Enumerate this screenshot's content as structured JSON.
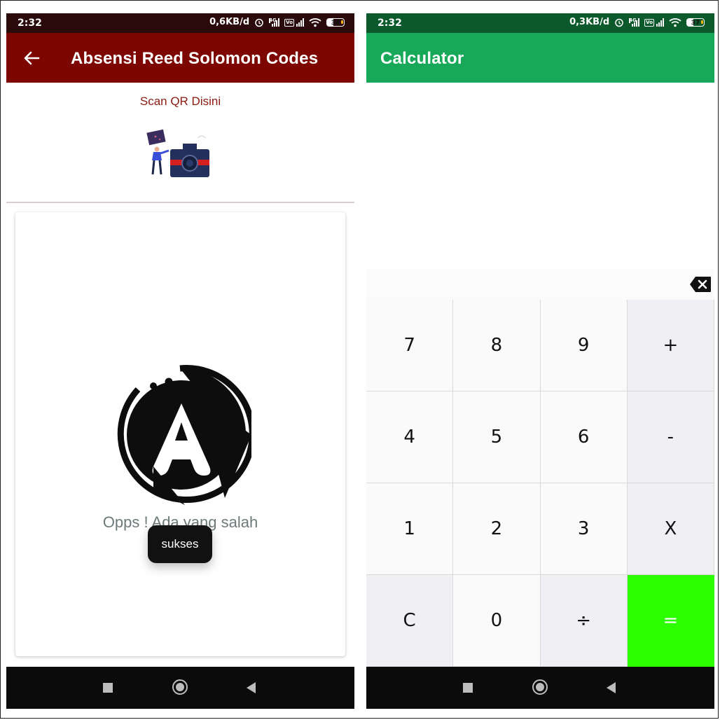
{
  "left": {
    "status_time": "2:32",
    "status_speed": "0,6KB/d",
    "battery": "38",
    "battery_level": 0.38,
    "title": "Absensi Reed Solomon Codes",
    "scan_label": "Scan QR Disini",
    "error_text": "Opps ! Ada yang salah",
    "toast": "sukses",
    "colors": {
      "appbar": "#7e0600",
      "statusbar": "#2a0a0a",
      "scan_label": "#8b1a10"
    },
    "icons": [
      "back-arrow-icon",
      "scan-illustration",
      "app-logo-icon"
    ]
  },
  "right": {
    "status_time": "2:32",
    "status_speed": "0,3KB/d",
    "battery": "37",
    "battery_level": 0.37,
    "title": "Calculator",
    "colors": {
      "appbar": "#18a85a",
      "statusbar": "#0c5a2c",
      "equals": "#2cff00"
    },
    "keys": [
      "7",
      "8",
      "9",
      "+",
      "4",
      "5",
      "6",
      "-",
      "1",
      "2",
      "3",
      "X",
      "C",
      "0",
      "÷",
      "="
    ]
  },
  "status_icons": [
    "alarm-icon",
    "4g-signal-icon",
    "volte-signal-icon",
    "wifi-icon",
    "battery-icon"
  ],
  "nav_icons": [
    "nav-recents-icon",
    "nav-home-icon",
    "nav-back-icon"
  ]
}
